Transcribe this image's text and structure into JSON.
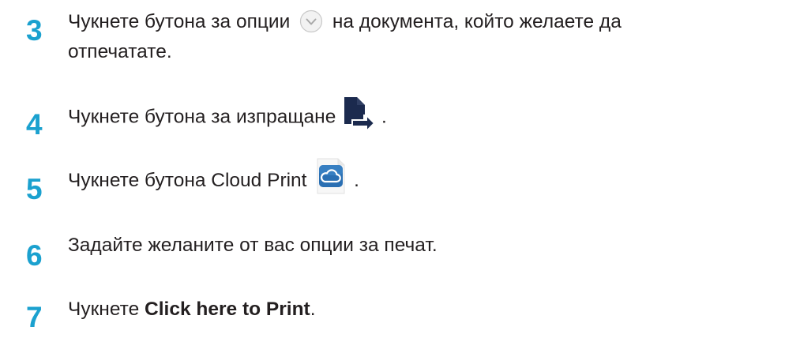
{
  "steps": [
    {
      "number": "3",
      "text_before_icon": "Чукнете бутона за опции",
      "icon": "options-chevron-icon",
      "text_after_icon": "на документа, който желаете да",
      "text_line2": "отпечатате."
    },
    {
      "number": "4",
      "text_before_icon": "Чукнете бутона за изпращане",
      "icon": "send-icon",
      "text_after_icon": "."
    },
    {
      "number": "5",
      "text_before_icon": "Чукнете бутона Cloud Print",
      "icon": "cloud-print-icon",
      "text_after_icon": "."
    },
    {
      "number": "6",
      "text": "Задайте желаните от вас опции за печат."
    },
    {
      "number": "7",
      "text_before": "Чукнете ",
      "text_bold": "Click here to Print",
      "text_after": "."
    }
  ],
  "colors": {
    "step_number": "#1ba1cf",
    "text": "#231f20",
    "send_icon": "#1b2a4e",
    "cloud_icon": "#2a6fb3"
  }
}
